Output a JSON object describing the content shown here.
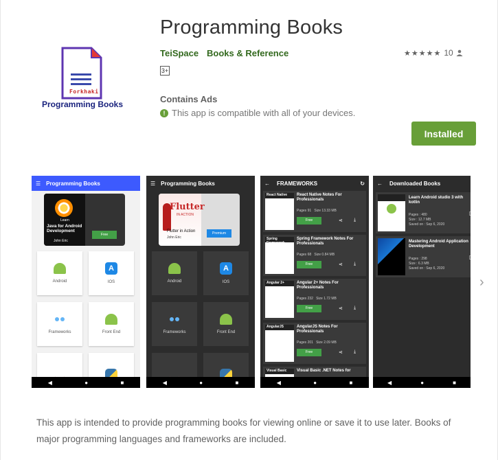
{
  "app": {
    "title": "Programming Books",
    "developer": "TeiSpace",
    "category": "Books & Reference",
    "rating_count": "10",
    "age_rating": "3+",
    "contains_ads": "Contains Ads",
    "compat_text": "This app is compatible with all of your devices.",
    "install_label": "Installed",
    "icon_brand": "Forkhaki",
    "icon_caption": "Programming Books",
    "stars": "★★★★★",
    "description": "This app is intended to provide programming books for viewing online or save it to use later. Books of major programming languages and frameworks are included."
  },
  "screenshots": {
    "s1": {
      "header": "Programming Books",
      "hero_learn": "Learn",
      "hero_title": "Java for Android Development",
      "hero_author": "John Eric",
      "hero_btn": "Free",
      "tiles": [
        "Android",
        "IOS",
        "Frameworks",
        "Front End"
      ]
    },
    "s2": {
      "header": "Programming Books",
      "hero_title": "Flutter",
      "hero_sub": "IN ACTION",
      "hero_caption": "Flutter in Action",
      "hero_author": "John Eric",
      "hero_btn": "Premium",
      "tiles": [
        "Android",
        "IOS",
        "Frameworks",
        "Front End"
      ]
    },
    "s3": {
      "header": "FRAMEWORKS",
      "books": [
        {
          "cover": "React Native",
          "title": "React Native Notes For Professionals",
          "pages": "Pages 91",
          "size": "Size 13.33 MB",
          "btn": "Free"
        },
        {
          "cover": "Spring Framework",
          "title": "Spring Framework Notes For Professionals",
          "pages": "Pages 68",
          "size": "Size 0.84 MB",
          "btn": "Free"
        },
        {
          "cover": "Angular 2+",
          "title": "Angular 2+ Notes For Professionals",
          "pages": "Pages 232",
          "size": "Size 1.72 MB",
          "btn": "Free"
        },
        {
          "cover": "AngularJS",
          "title": "AngularJS Notes For Professionals",
          "pages": "Pages 201",
          "size": "Size 2.09 MB",
          "btn": "Free"
        },
        {
          "cover": "Visual Basic",
          "title": "Visual Basic .NET Notes for",
          "pages": "",
          "size": "",
          "btn": ""
        }
      ]
    },
    "s4": {
      "header": "Downloaded Books",
      "books": [
        {
          "title": "Learn Android studio 3 with kotlin",
          "pages": "Pages : 480",
          "size": "Size : 12.7 MB",
          "saved": "Saved on : Sep 6, 2020"
        },
        {
          "title": "Mastering Android Application Development",
          "pages": "Pages : 298",
          "size": "Size : 6.3 MB",
          "saved": "Saved on : Sep 6, 2020"
        }
      ]
    }
  },
  "colors": {
    "accent_green": "#689f38",
    "link_green": "#33691e",
    "light_header": "#3d5afe"
  }
}
